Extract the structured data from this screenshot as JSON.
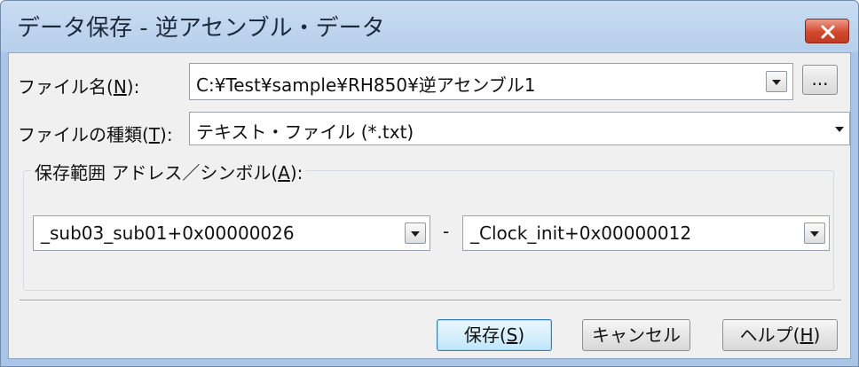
{
  "window": {
    "title": "データ保存 - 逆アセンブル・データ",
    "close_icon": "close-x-icon"
  },
  "file_name": {
    "label_pre": "ファイル名(",
    "label_key": "N",
    "label_post": "):",
    "value": "C:¥Test¥sample¥RH850¥逆アセンブル1",
    "browse_label": "..."
  },
  "file_type": {
    "label_pre": "ファイルの種類(",
    "label_key": "T",
    "label_post": "):",
    "selected": "テキスト・ファイル (*.txt)"
  },
  "range": {
    "group_title_pre": "保存範囲 アドレス／シンボル(",
    "group_title_key": "A",
    "group_title_post": "):",
    "start_value": "_sub03_sub01+0x00000026",
    "separator": "-",
    "end_value": "_Clock_init+0x00000012"
  },
  "buttons": {
    "save_pre": "保存(",
    "save_key": "S",
    "save_post": ")",
    "cancel": "キャンセル",
    "help_pre": "ヘルプ(",
    "help_key": "H",
    "help_post": ")"
  },
  "colors": {
    "title_bar": "#b7cfeb",
    "client_bg": "#f0f0f0",
    "close_button": "#d2492f",
    "default_button_border": "#3c7fb1"
  }
}
